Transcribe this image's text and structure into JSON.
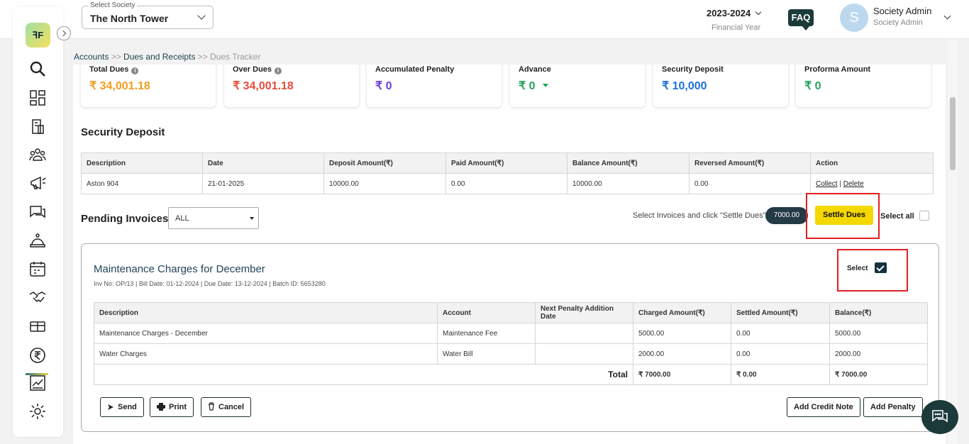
{
  "header": {
    "society_label": "Select Society",
    "society_value": "The North Tower",
    "financial_year": "2023-2024",
    "financial_year_label": "Financial Year",
    "faq": "FAQ",
    "user_initial": "S",
    "user_name": "Society Admin",
    "user_role": "Society Admin"
  },
  "sidebar": {
    "logo": "ꟻF",
    "items": [
      "search-icon",
      "dashboard-icon",
      "building-icon",
      "members-icon",
      "announcement-icon",
      "chat-icon",
      "helpdesk-icon",
      "calendar-icon",
      "handshake-icon",
      "facility-icon",
      "rupee-icon",
      "reports-icon",
      "settings-icon"
    ]
  },
  "breadcrumb": {
    "l1": "Accounts",
    "sep1": " >> ",
    "l2": "Dues and Receipts",
    "sep2": " >> ",
    "l3": "Dues Tracker"
  },
  "stats": [
    {
      "title": "Total Dues",
      "value": "₹ 34,001.18",
      "color": "#f39c1f"
    },
    {
      "title": "Over Dues",
      "value": "₹ 34,001.18",
      "color": "#e74c3c"
    },
    {
      "title": "Accumulated Penalty",
      "value": "₹ 0",
      "color": "#6c3fd6"
    },
    {
      "title": "Advance",
      "value": "₹ 0",
      "color": "#23a35a"
    },
    {
      "title": "Security Deposit",
      "value": "₹ 10,000",
      "color": "#1e6fd9"
    },
    {
      "title": "Proforma Amount",
      "value": "₹ 0",
      "color": "#23a35a"
    }
  ],
  "security_deposit": {
    "title": "Security Deposit",
    "headers": [
      "Description",
      "Date",
      "Deposit Amount(₹)",
      "Paid Amount(₹)",
      "Balance Amount(₹)",
      "Reversed Amount(₹)",
      "Action"
    ],
    "row": {
      "description": "Aston 904",
      "date": "21-01-2025",
      "deposit": "10000.00",
      "paid": "0.00",
      "balance": "10000.00",
      "reversed": "0.00",
      "collect": "Collect",
      "sep": "|",
      "delete": "Delete"
    }
  },
  "pending": {
    "title": "Pending Invoices",
    "filter": "ALL",
    "hint": "Select Invoices and click \"Settle Dues\"",
    "selected_amount": "7000.00",
    "settle_label": "Settle Dues",
    "select_all": "Select all"
  },
  "invoice": {
    "title": "Maintenance Charges for December",
    "meta": "Inv No: OP/13 | Bill Date: 01-12-2024 | Due Date: 13-12-2024 | Batch ID: 5653280",
    "select_label": "Select",
    "headers": [
      "Description",
      "Account",
      "Next Penalty Addition Date",
      "Charged Amount(₹)",
      "Settled Amount(₹)",
      "Balance(₹)"
    ],
    "rows": [
      {
        "description": "Maintenance Charges - December",
        "account": "Maintenance Fee",
        "next": "",
        "charged": "5000.00",
        "settled": "0.00",
        "balance": "5000.00"
      },
      {
        "description": "Water Charges",
        "account": "Water Bill",
        "next": "",
        "charged": "2000.00",
        "settled": "0.00",
        "balance": "2000.00"
      }
    ],
    "total_label": "Total",
    "total_charged": "₹ 7000.00",
    "total_settled": "₹ 0.00",
    "total_balance": "₹ 7000.00",
    "buttons": {
      "send": "Send",
      "print": "Print",
      "cancel": "Cancel",
      "credit": "Add Credit Note",
      "penalty": "Add Penalty"
    }
  }
}
